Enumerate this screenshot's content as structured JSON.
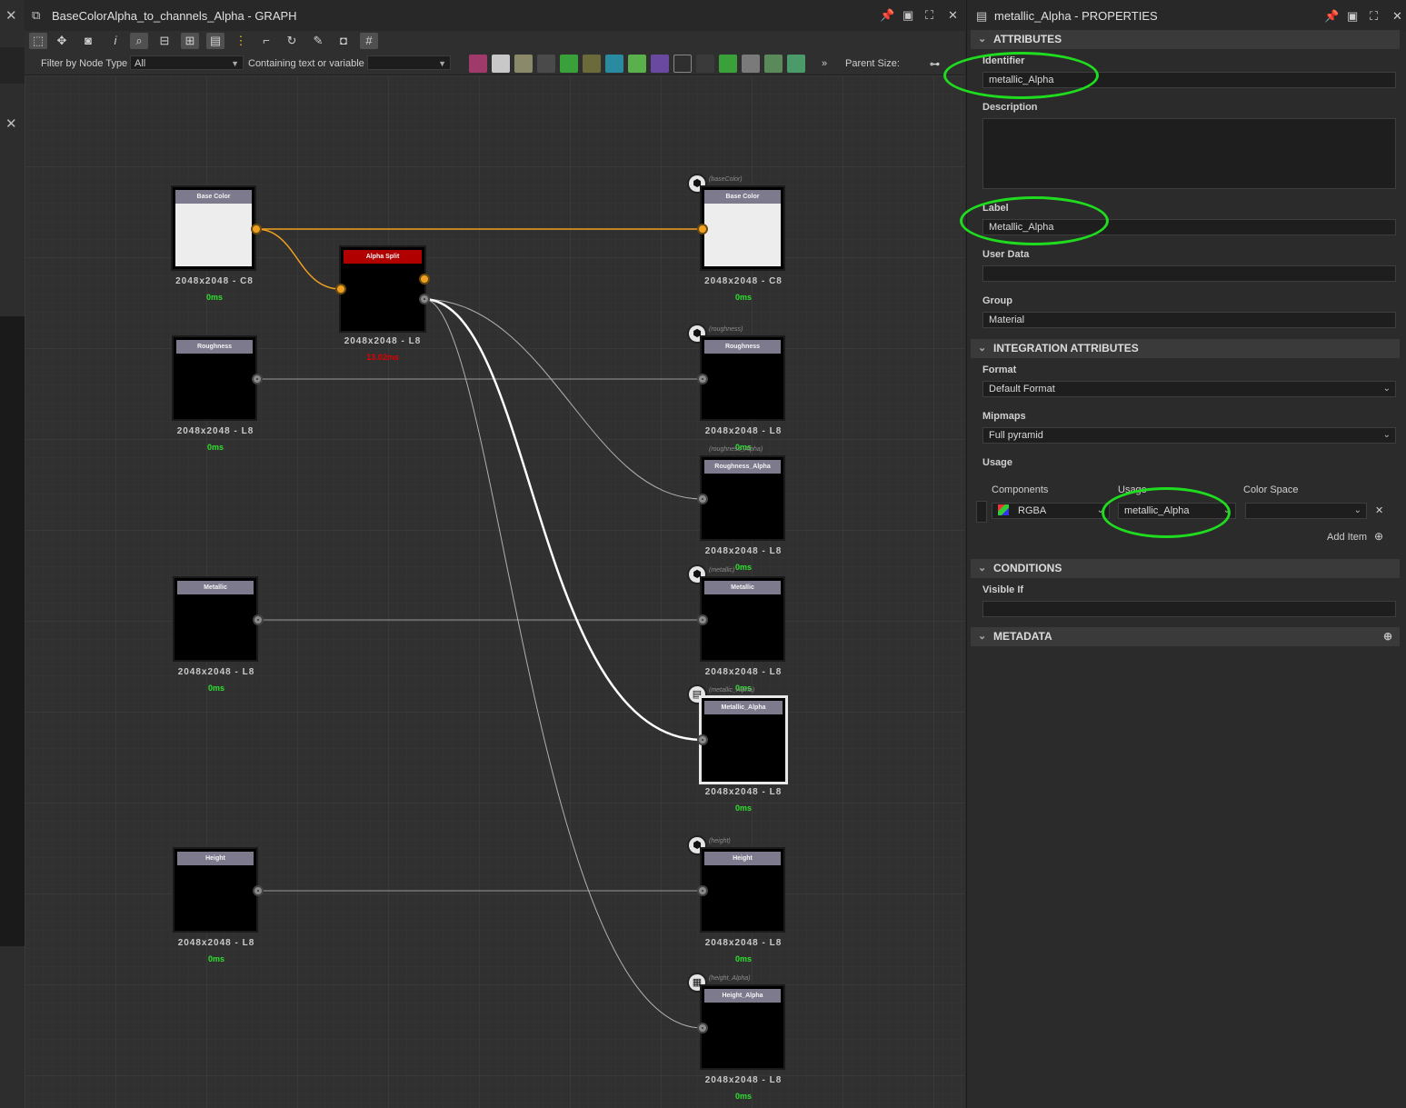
{
  "graph": {
    "title": "BaseColorAlpha_to_channels_Alpha - GRAPH",
    "filter_label": "Filter by Node Type",
    "filter_value": "All",
    "containing_label": "Containing text or variable",
    "containing_value": "",
    "parent_size_label": "Parent Size:",
    "more_label": "»"
  },
  "nodes": {
    "input_base_color": {
      "title": "Base Color",
      "res": "2048x2048 - C8",
      "time": "0ms"
    },
    "input_roughness": {
      "title": "Roughness",
      "res": "2048x2048 - L8",
      "time": "0ms"
    },
    "input_metallic": {
      "title": "Metallic",
      "res": "2048x2048 - L8",
      "time": "0ms"
    },
    "input_height": {
      "title": "Height",
      "res": "2048x2048 - L8",
      "time": "0ms"
    },
    "alpha_split": {
      "title": "Alpha Split",
      "res": "2048x2048 - L8",
      "time": "13.02ms"
    },
    "out_base_color": {
      "title": "Base Color",
      "id": "(baseColor)",
      "res": "2048x2048 - C8",
      "time": "0ms"
    },
    "out_roughness": {
      "title": "Roughness",
      "id": "(roughness)",
      "res": "2048x2048 - L8",
      "time": "0ms"
    },
    "out_roughness_alpha": {
      "title": "Roughness_Alpha",
      "id": "(roughness_Alpha)",
      "res": "2048x2048 - L8",
      "time": "0ms"
    },
    "out_metallic": {
      "title": "Metallic",
      "id": "(metallic)",
      "res": "2048x2048 - L8",
      "time": "0ms"
    },
    "out_metallic_alpha": {
      "title": "Metallic_Alpha",
      "id": "(metallic_Alpha)",
      "res": "2048x2048 - L8",
      "time": "0ms"
    },
    "out_height": {
      "title": "Height",
      "id": "(height)",
      "res": "2048x2048 - L8",
      "time": "0ms"
    },
    "out_height_alpha": {
      "title": "Height_Alpha",
      "id": "(height_Alpha)",
      "res": "2048x2048 - L8",
      "time": "0ms"
    }
  },
  "props": {
    "title": "metallic_Alpha - PROPERTIES",
    "sections": {
      "attributes": "ATTRIBUTES",
      "integration": "INTEGRATION ATTRIBUTES",
      "conditions": "CONDITIONS",
      "metadata": "METADATA"
    },
    "identifier_label": "Identifier",
    "identifier_value": "metallic_Alpha",
    "description_label": "Description",
    "description_value": "",
    "label_label": "Label",
    "label_value": "Metallic_Alpha",
    "user_data_label": "User Data",
    "user_data_value": "",
    "group_label": "Group",
    "group_value": "Material",
    "format_label": "Format",
    "format_value": "Default Format",
    "mipmaps_label": "Mipmaps",
    "mipmaps_value": "Full pyramid",
    "usage_label": "Usage",
    "col_components": "Components",
    "col_usage": "Usage",
    "col_colorspace": "Color Space",
    "usage_components": "RGBA",
    "usage_value": "metallic_Alpha",
    "usage_colorspace": "",
    "add_item": "Add Item",
    "visible_if_label": "Visible If",
    "visible_if_value": ""
  },
  "colors": {
    "accent_highlight": "#1fdc1f",
    "link_orange": "#f0a020",
    "alpha_split_header": "#b00000",
    "time_green": "#2ee02e",
    "time_red": "#e00000"
  },
  "icons": [
    "close-icon",
    "graph-icon",
    "pin-icon",
    "float-icon",
    "maximize-icon",
    "select-icon",
    "move-icon",
    "camera-icon",
    "info-icon",
    "zoom-icon",
    "frame-icon",
    "layout-icon",
    "align-icon",
    "settings-icon",
    "document-icon",
    "plus-circle-icon",
    "output-icon"
  ]
}
